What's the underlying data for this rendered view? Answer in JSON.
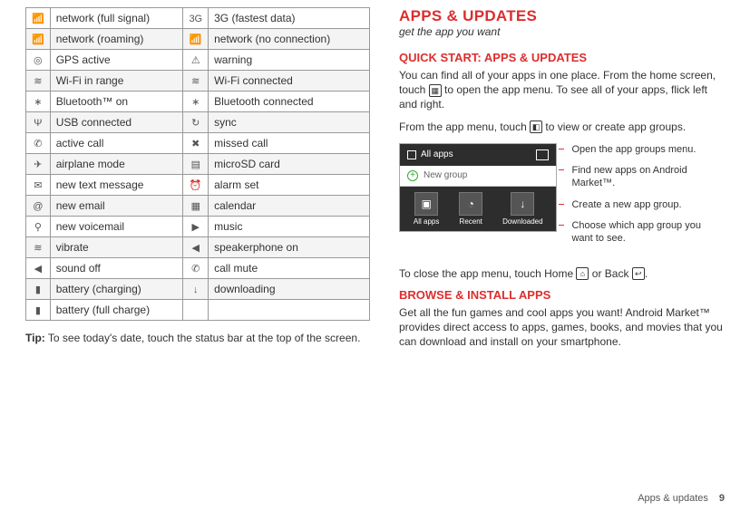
{
  "status_table": {
    "rows": [
      {
        "l": "network (full signal)",
        "r": "3G (fastest data)",
        "li": "📶",
        "ri": "3G"
      },
      {
        "l": "network (roaming)",
        "r": "network (no connection)",
        "li": "📶",
        "ri": "📶",
        "alt": true
      },
      {
        "l": "GPS active",
        "r": "warning",
        "li": "◎",
        "ri": "⚠"
      },
      {
        "l": "Wi-Fi in range",
        "r": "Wi-Fi connected",
        "li": "≋",
        "ri": "≋",
        "alt": true
      },
      {
        "l": "Bluetooth™ on",
        "r": "Bluetooth connected",
        "li": "∗",
        "ri": "∗"
      },
      {
        "l": "USB connected",
        "r": "sync",
        "li": "Ψ",
        "ri": "↻",
        "alt": true
      },
      {
        "l": "active call",
        "r": "missed call",
        "li": "✆",
        "ri": "✖"
      },
      {
        "l": "airplane mode",
        "r": "microSD card",
        "li": "✈",
        "ri": "▤",
        "alt": true
      },
      {
        "l": "new text message",
        "r": "alarm set",
        "li": "✉",
        "ri": "⏰"
      },
      {
        "l": "new email",
        "r": "calendar",
        "li": "@",
        "ri": "▦",
        "alt": true
      },
      {
        "l": "new voicemail",
        "r": "music",
        "li": "⚲",
        "ri": "▶"
      },
      {
        "l": "vibrate",
        "r": "speakerphone on",
        "li": "≋",
        "ri": "◀",
        "alt": true
      },
      {
        "l": "sound off",
        "r": "call mute",
        "li": "◀",
        "ri": "✆"
      },
      {
        "l": "battery (charging)",
        "r": "downloading",
        "li": "▮",
        "ri": "↓",
        "alt": true
      },
      {
        "l": "battery (full charge)",
        "r": "",
        "li": "▮",
        "ri": ""
      }
    ]
  },
  "tip_label": "Tip:",
  "tip_text": " To see today's date, touch the status bar at the top of the screen.",
  "h1": "APPS & UPDATES",
  "h1_sub": "get the app you want",
  "h2a": "Quick start: Apps & updates",
  "p1a": "You can find all of your apps in one place. From the home screen, touch ",
  "p1b": " to open the app menu. To see all of your apps, flick left and right.",
  "p2a": "From the app menu, touch ",
  "p2b": " to view or create app groups.",
  "phone": {
    "title": "All apps",
    "new_group": "New group",
    "btn1": "All apps",
    "btn2": "Recent",
    "btn3": "Downloaded"
  },
  "callouts": {
    "c1": "Open the app groups menu.",
    "c2": "Find new apps on Android Market™.",
    "c3": "Create a new app group.",
    "c4": "Choose which app group you want to see."
  },
  "p3a": "To close the app menu, touch Home ",
  "p3b": " or Back ",
  "p3c": ".",
  "h2b": "Browse & install apps",
  "p4": "Get all the fun games and cool apps you want! Android Market™ provides direct access to apps, games, books, and movies that you can download and install on your smartphone.",
  "footer_section": "Apps & updates",
  "footer_page": "9"
}
